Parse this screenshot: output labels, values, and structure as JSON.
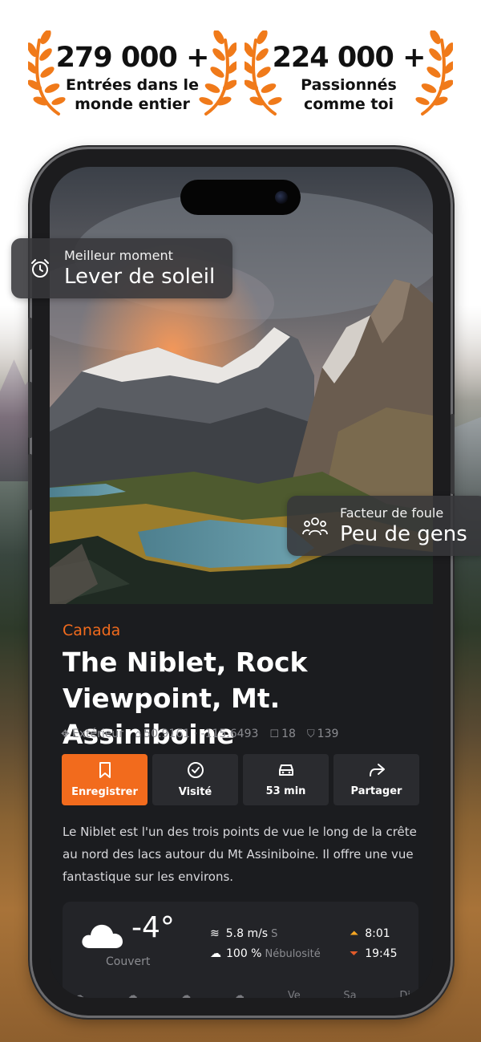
{
  "awards": [
    {
      "count": "279 000 +",
      "label": "Entrées dans le monde entier"
    },
    {
      "count": "224 000 +",
      "label": "Passionnés comme toi"
    }
  ],
  "badges": {
    "best_time": {
      "label": "Meilleur moment",
      "value": "Lever de soleil",
      "icon": "alarm-clock-icon"
    },
    "crowd": {
      "label": "Facteur de foule",
      "value": "Peu de gens",
      "icon": "people-icon"
    }
  },
  "location": {
    "country": "Canada",
    "title": "The Niblet, Rock Viewpoint, Mt. Assiniboine",
    "type": "Extérieur",
    "coordinates": "50.9161 · -115.6493",
    "comments": "18",
    "saves": "139"
  },
  "actions": {
    "save": "Enregistrer",
    "visited": "Visité",
    "drive": "53 min",
    "share": "Partager"
  },
  "description": "Le Niblet est l'un des trois points de vue le long de la crête au nord des lacs autour du Mt Assiniboine. Il offre une vue fantastique sur les environs.",
  "weather": {
    "temperature": "-4°",
    "condition": "Couvert",
    "wind": "5.8 m/s",
    "wind_dir": "S",
    "cloud_cover": "100 %",
    "cloud_label": "Nébulosité",
    "sunrise": "8:01",
    "sunset": "19:45",
    "days": [
      "Ve",
      "Sa",
      "Di"
    ]
  },
  "colors": {
    "accent": "#f26b1d",
    "laurel": "#f07a1a",
    "card": "#1b1c1f"
  }
}
